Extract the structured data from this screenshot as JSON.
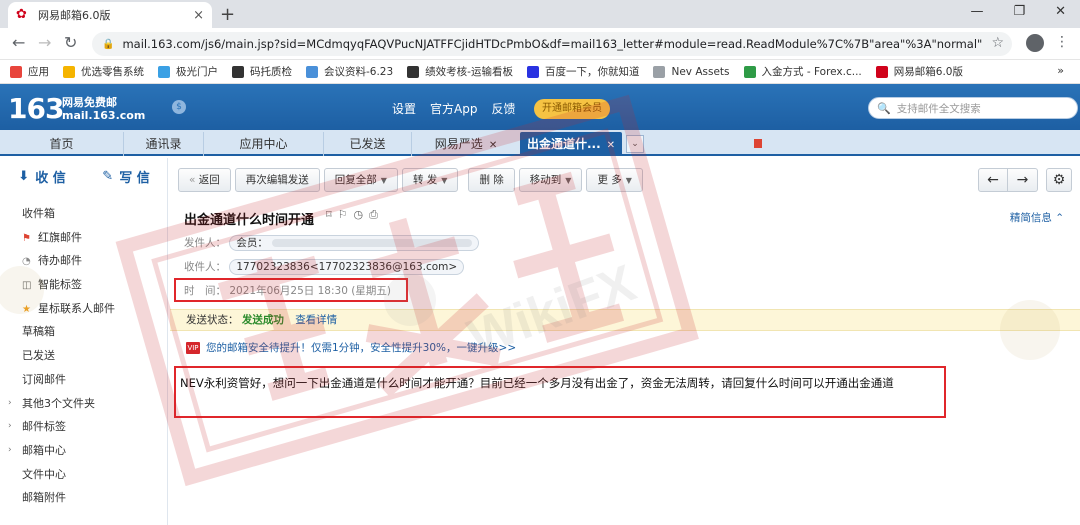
{
  "browser": {
    "tab_title": "网易邮箱6.0版",
    "tab_close": "×",
    "new_tab": "+",
    "url": "mail.163.com/js6/main.jsp?sid=MCdmqyqFAQVPucNJATFFCjidHTDcPmbO&df=mail163_letter#module=read.ReadModule%7C%7B\"area\"%3A\"normal\"...",
    "bookmarks": [
      {
        "label": "应用",
        "color": "#e8453c"
      },
      {
        "label": "优选零售系统",
        "color": "#f5b400"
      },
      {
        "label": "极光门户",
        "color": "#3aa0e4"
      },
      {
        "label": "码托质检",
        "color": "#333333"
      },
      {
        "label": "会议资料-6.23",
        "color": "#4a90d9"
      },
      {
        "label": "绩效考核-运输看板",
        "color": "#333333"
      },
      {
        "label": "百度一下，你就知道",
        "color": "#2932e1"
      },
      {
        "label": "Nev Assets",
        "color": "#9aa0a6"
      },
      {
        "label": "入金方式 - Forex.c...",
        "color": "#2e9b46"
      },
      {
        "label": "网易邮箱6.0版",
        "color": "#d0021b"
      }
    ],
    "bookmarks_more": "»"
  },
  "header": {
    "logo": "163",
    "logo_line1": "网易免费邮",
    "logo_line2": "mail.163.com",
    "links": [
      "设置",
      "官方App",
      "反馈"
    ],
    "vip_button": "开通邮箱会员",
    "search_placeholder": "支持邮件全文搜索"
  },
  "tabs": [
    {
      "label": "首页"
    },
    {
      "label": "通讯录"
    },
    {
      "label": "应用中心"
    },
    {
      "label": "已发送"
    },
    {
      "label": "网易严选"
    },
    {
      "label": "出金通道什..."
    }
  ],
  "sidebar": {
    "receive": "收 信",
    "compose": "写 信",
    "folders": [
      {
        "label": "收件箱",
        "icon": ""
      },
      {
        "label": "红旗邮件",
        "icon": "flag"
      },
      {
        "label": "待办邮件",
        "icon": "clock"
      },
      {
        "label": "智能标签",
        "icon": "tag"
      },
      {
        "label": "星标联系人邮件",
        "icon": "star"
      },
      {
        "label": "草稿箱",
        "icon": ""
      },
      {
        "label": "已发送",
        "icon": ""
      },
      {
        "label": "订阅邮件",
        "icon": ""
      },
      {
        "label": "其他3个文件夹",
        "icon": "",
        "expand": true
      },
      {
        "label": "邮件标签",
        "icon": "",
        "expand": true
      },
      {
        "label": "邮箱中心",
        "icon": "",
        "expand": true
      },
      {
        "label": "文件中心",
        "icon": ""
      },
      {
        "label": "邮箱附件",
        "icon": ""
      }
    ]
  },
  "toolbar": {
    "back": "返回",
    "resend": "再次编辑发送",
    "reply_all": "回复全部",
    "forward": "转 发",
    "delete": "删 除",
    "move_to": "移动到",
    "more": "更 多"
  },
  "message": {
    "subject": "出金通道什么时间开通",
    "brief_info": "精简信息",
    "sender_label": "发件人：",
    "sender_value": "会员：",
    "recipient_label": "收件人：",
    "recipient_value": "17702323836<17702323836@163.com>",
    "time_label": "时　间：",
    "time_value": "2021年06月25日 18:30 (星期五)",
    "status_label": "发送状态：",
    "status_value": "发送成功",
    "status_link": "查看详情",
    "security_badge": "VIP",
    "security_text": "您的邮箱安全待提升！仅需1分钟，安全性提升30%，一键升级>>",
    "body": "NEV永利资管好，想问一下出金通道是什么时间才能开通？目前已经一个多月没有出金了，资金无法周转，请回复什么时间可以开通出金通道"
  },
  "watermark": {
    "text": "WikiFX",
    "stamp": "天眼",
    "color": "#c8262b"
  }
}
